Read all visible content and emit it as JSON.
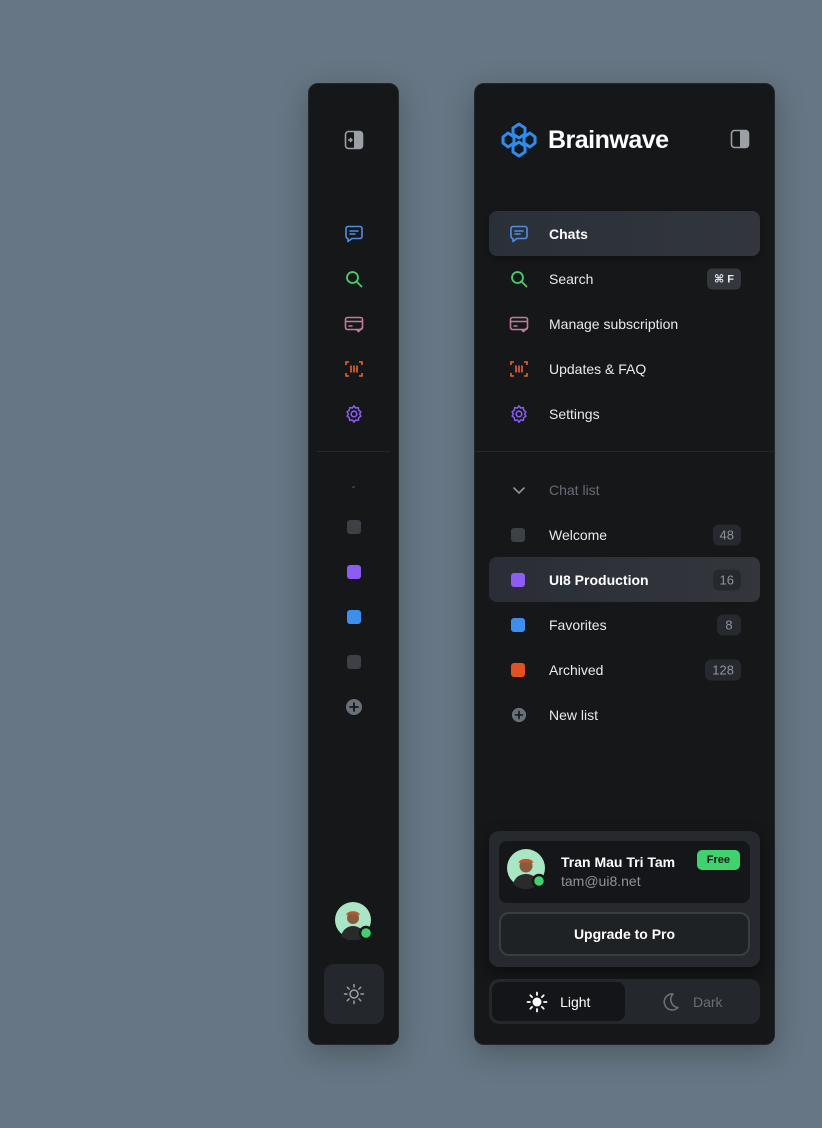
{
  "brand": {
    "name": "Brainwave",
    "accent": "#2b8cf4"
  },
  "nav": [
    {
      "label": "Chats",
      "icon": "chat-icon",
      "color": "#4a90e2",
      "active": true
    },
    {
      "label": "Search",
      "icon": "search-icon",
      "color": "#3dd46f",
      "shortcut": "⌘ F"
    },
    {
      "label": "Manage subscription",
      "icon": "card-check-icon",
      "color": "#c27ba0"
    },
    {
      "label": "Updates & FAQ",
      "icon": "barcode-scan-icon",
      "color": "#e8642c"
    },
    {
      "label": "Settings",
      "icon": "gear-icon",
      "color": "#8b5cf6"
    }
  ],
  "rail": {
    "dash": "-"
  },
  "chat_lists": {
    "header": "Chat list",
    "items": [
      {
        "label": "Welcome",
        "count": "48",
        "color": "#3d4044"
      },
      {
        "label": "UI8 Production",
        "count": "16",
        "color": "#8b5cf6",
        "active": true
      },
      {
        "label": "Favorites",
        "count": "8",
        "color": "#3b8ff0"
      },
      {
        "label": "Archived",
        "count": "128",
        "color": "#e4511d"
      }
    ],
    "new_list": "New list"
  },
  "user": {
    "name": "Tran Mau Tri Tam",
    "email": "tam@ui8.net",
    "plan": "Free",
    "status_color": "#3dd46f"
  },
  "upgrade_label": "Upgrade to Pro",
  "theme": {
    "light": "Light",
    "dark": "Dark",
    "selected": "Light"
  }
}
